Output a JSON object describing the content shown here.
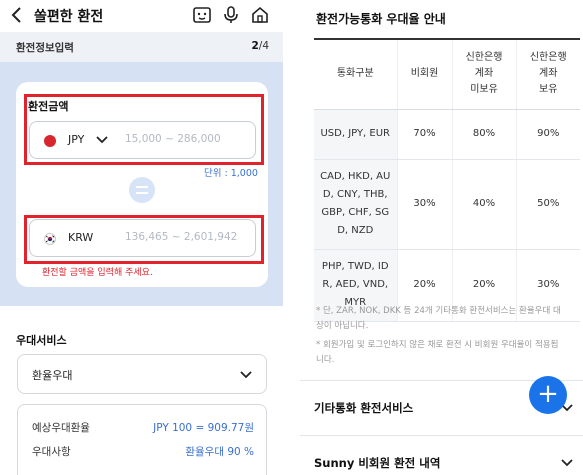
{
  "left": {
    "header": {
      "title": "쏠편한 환전"
    },
    "stepbar": {
      "label": "환전정보입력",
      "current": "2",
      "total": "/4"
    },
    "amount": {
      "label": "환전금액",
      "from": {
        "currency": "JPY",
        "placeholder": "15,000 ~ 286,000"
      },
      "unit": "단위 : 1,000",
      "to": {
        "currency": "KRW",
        "placeholder": "136,465 ~ 2,601,942"
      },
      "error": "환전할 금액을 입력해 주세요."
    },
    "benefit": {
      "title": "우대서비스",
      "selected": "환율우대",
      "rows": [
        {
          "key": "예상우대환율",
          "value": "JPY 100 = 909.77원"
        },
        {
          "key": "우대사항",
          "value": "환율우대 90 %"
        }
      ]
    }
  },
  "right": {
    "title": "환전가능통화 우대율 안내",
    "table": {
      "headers": [
        "통화구분",
        "비회원",
        "신한은행\n계좌\n미보유",
        "신한은행\n계좌\n보유"
      ],
      "rows": [
        [
          "USD, JPY, EUR",
          "70%",
          "80%",
          "90%"
        ],
        [
          "CAD, HKD, AUD, CNY, THB, GBP, CHF, SGD, NZD",
          "30%",
          "40%",
          "50%"
        ],
        [
          "PHP, TWD, IDR, AED, VND, MYR",
          "20%",
          "20%",
          "30%"
        ]
      ]
    },
    "notes": [
      "* 단, ZAR, NOK, DKK 등 24개 기타통화 환전서비스는 환율우대 대상이 아닙니다.",
      "* 회원가입 및 로그인하지 않은 채로 환전 시 비회원 우대율이 적용됩니다."
    ],
    "links": [
      "기타통화 환전서비스",
      "Sunny 비회원 환전 내역"
    ],
    "fab": "+"
  },
  "colors": {
    "accent": "#1a73e8",
    "highlight": "#e0232d",
    "formBg": "#d6e1f3"
  }
}
